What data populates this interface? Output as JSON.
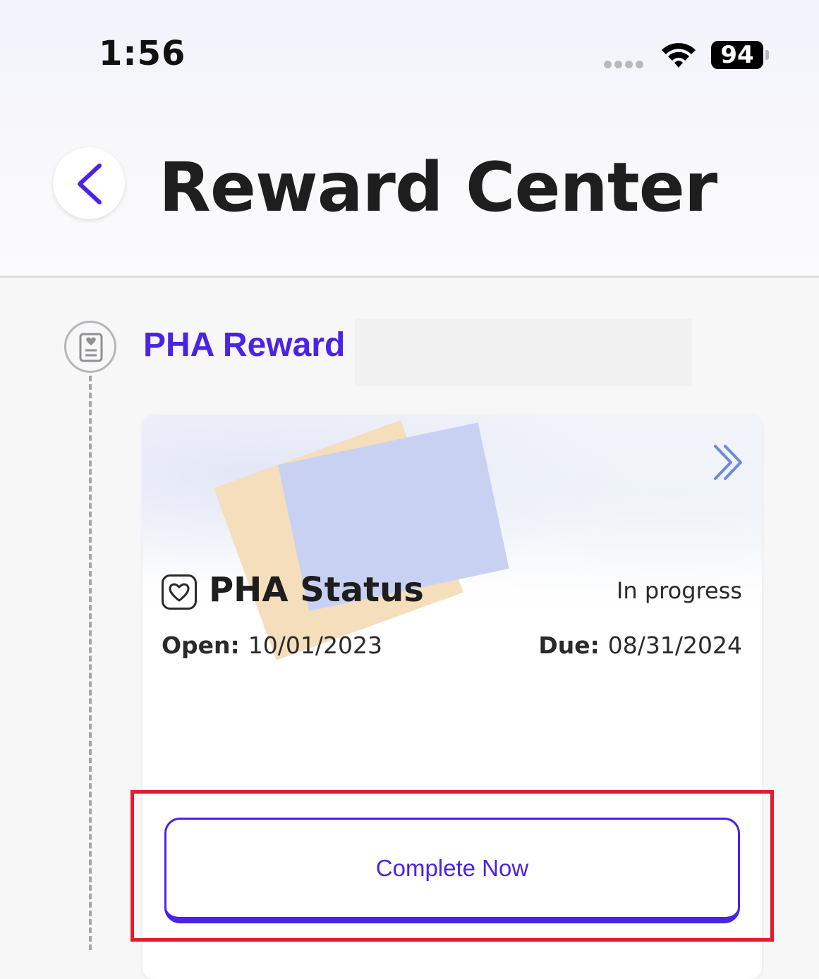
{
  "status_bar": {
    "time": "1:56",
    "battery": "94"
  },
  "header": {
    "title": "Reward Center",
    "back_icon": "chevron-left-icon"
  },
  "section": {
    "title": "PHA Reward",
    "icon": "health-record-icon"
  },
  "card": {
    "title": "PHA Status",
    "title_icon": "heart-icon",
    "status": "In progress",
    "open_label": "Open:",
    "open_date": "10/01/2023",
    "due_label": "Due:",
    "due_date": "08/31/2024",
    "arrow_icon": "double-chevron-right-icon",
    "action_label": "Complete Now"
  },
  "colors": {
    "accent": "#4a23e6",
    "highlight": "#e41b2b"
  }
}
